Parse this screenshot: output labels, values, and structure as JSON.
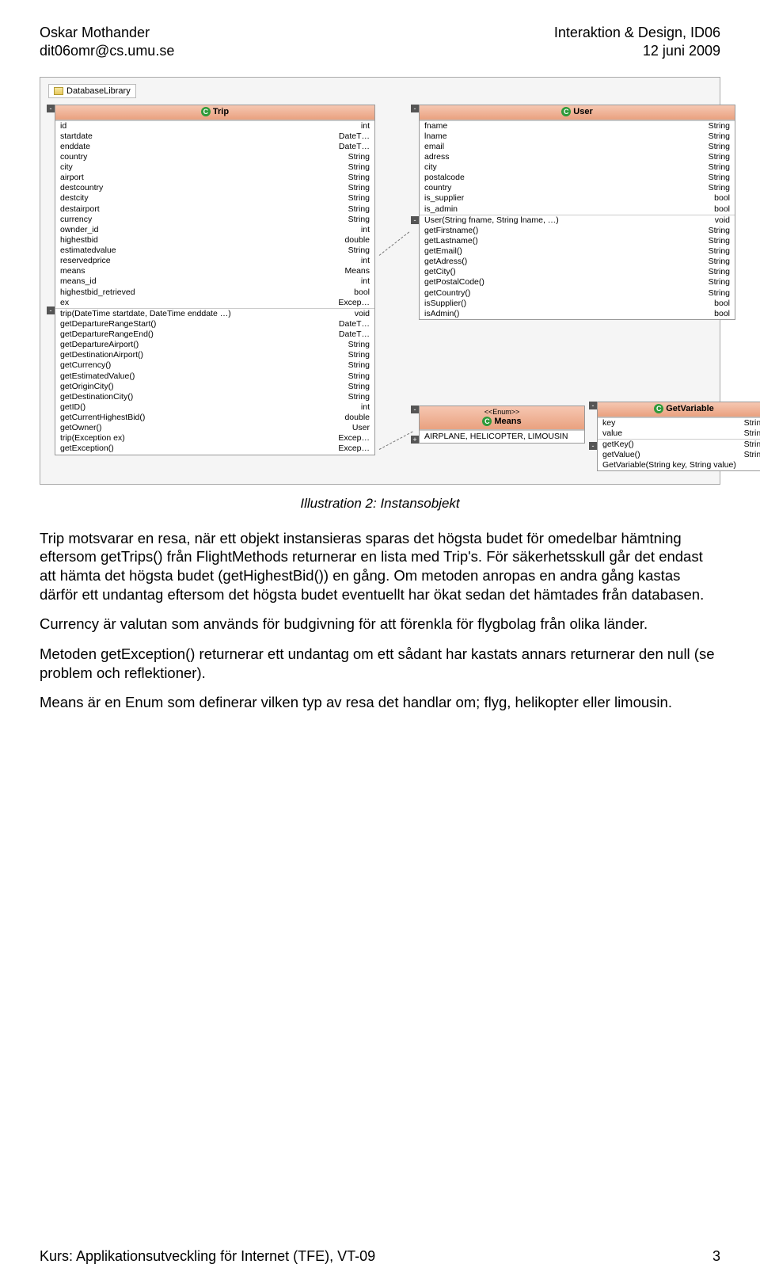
{
  "header": {
    "left_name": "Oskar Mothander",
    "left_email": "dit06omr@cs.umu.se",
    "right_course": "Interaktion & Design, ID06",
    "right_date": "12 juni 2009"
  },
  "diagram": {
    "library_label": "DatabaseLibrary",
    "trip": {
      "title": "Trip",
      "fields": [
        [
          "id",
          "int"
        ],
        [
          "startdate",
          "DateT…"
        ],
        [
          "enddate",
          "DateT…"
        ],
        [
          "country",
          "String"
        ],
        [
          "city",
          "String"
        ],
        [
          "airport",
          "String"
        ],
        [
          "destcountry",
          "String"
        ],
        [
          "destcity",
          "String"
        ],
        [
          "destairport",
          "String"
        ],
        [
          "currency",
          "String"
        ],
        [
          "ownder_id",
          "int"
        ],
        [
          "highestbid",
          "double"
        ],
        [
          "estimatedvalue",
          "String"
        ],
        [
          "reservedprice",
          "int"
        ],
        [
          "means",
          "Means"
        ],
        [
          "means_id",
          "int"
        ],
        [
          "highestbid_retrieved",
          "bool"
        ],
        [
          "ex",
          "Excep…"
        ]
      ],
      "methods": [
        [
          "trip(DateTime startdate, DateTime enddate …)",
          "void"
        ],
        [
          "getDepartureRangeStart()",
          "DateT…"
        ],
        [
          "getDepartureRangeEnd()",
          "DateT…"
        ],
        [
          "getDepartureAirport()",
          "String"
        ],
        [
          "getDestinationAirport()",
          "String"
        ],
        [
          "getCurrency()",
          "String"
        ],
        [
          "getEstimatedValue()",
          "String"
        ],
        [
          "getOriginCity()",
          "String"
        ],
        [
          "getDestinationCity()",
          "String"
        ],
        [
          "getID()",
          "int"
        ],
        [
          "getCurrentHighestBid()",
          "double"
        ],
        [
          "getOwner()",
          "User"
        ],
        [
          "trip(Exception ex)",
          "Excep…"
        ],
        [
          "getException()",
          "Excep…"
        ]
      ]
    },
    "user": {
      "title": "User",
      "fields": [
        [
          "fname",
          "String"
        ],
        [
          "lname",
          "String"
        ],
        [
          "email",
          "String"
        ],
        [
          "adress",
          "String"
        ],
        [
          "city",
          "String"
        ],
        [
          "postalcode",
          "String"
        ],
        [
          "country",
          "String"
        ],
        [
          "is_supplier",
          "bool"
        ],
        [
          "is_admin",
          "bool"
        ]
      ],
      "methods": [
        [
          "User(String fname, String lname, …)",
          "void"
        ],
        [
          "getFirstname()",
          "String"
        ],
        [
          "getLastname()",
          "String"
        ],
        [
          "getEmail()",
          "String"
        ],
        [
          "getAdress()",
          "String"
        ],
        [
          "getCity()",
          "String"
        ],
        [
          "getPostalCode()",
          "String"
        ],
        [
          "getCountry()",
          "String"
        ],
        [
          "isSupplier()",
          "bool"
        ],
        [
          "isAdmin()",
          "bool"
        ]
      ]
    },
    "means": {
      "stereotype": "<<Enum>>",
      "title": "Means",
      "values": "AIRPLANE, HELICOPTER, LIMOUSIN"
    },
    "getvar": {
      "title": "GetVariable",
      "fields": [
        [
          "key",
          "String"
        ],
        [
          "value",
          "String"
        ]
      ],
      "methods": [
        [
          "getKey()",
          "String"
        ],
        [
          "getValue()",
          "String"
        ],
        [
          "GetVariable(String key, String value)",
          ""
        ]
      ]
    }
  },
  "caption": "Illustration 2: Instansobjekt",
  "paragraphs": {
    "p1": "Trip motsvarar en resa, när ett objekt instansieras sparas det högsta budet för omedelbar hämtning eftersom getTrips() från FlightMethods returnerar en lista med Trip's. För säkerhetsskull går det endast att hämta det högsta budet (getHighestBid()) en gång. Om metoden anropas en andra gång kastas därför ett undantag eftersom det högsta budet eventuellt har ökat sedan det hämtades från databasen.",
    "p2": "Currency är valutan som används för budgivning för att förenkla för flygbolag från olika länder.",
    "p3": "Metoden getException() returnerar ett undantag om ett sådant har kastats annars returnerar den null (se problem och reflektioner).",
    "p4": "Means är en Enum som definerar vilken typ av resa det handlar om; flyg, helikopter eller limousin."
  },
  "footer": {
    "course": "Kurs: Applikationsutveckling för Internet (TFE), VT-09",
    "page": "3"
  }
}
